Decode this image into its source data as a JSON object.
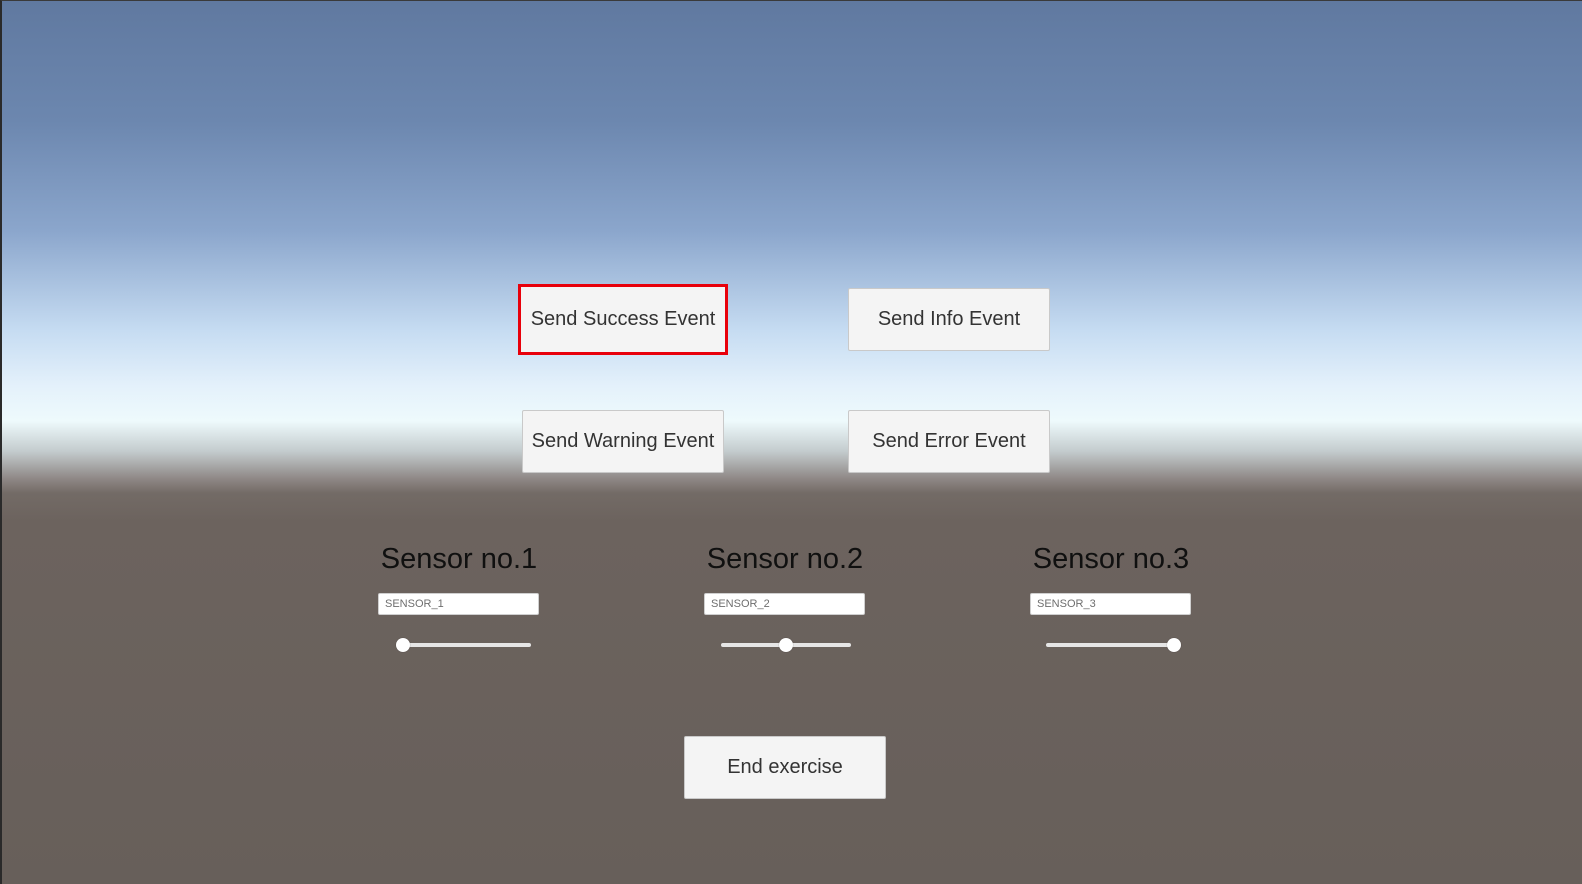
{
  "buttons": {
    "success": "Send Success Event",
    "info": "Send Info Event",
    "warning": "Send Warning Event",
    "error": "Send Error Event",
    "end": "End exercise"
  },
  "highlight_color": "#e8000b",
  "sensors": [
    {
      "title": "Sensor no.1",
      "input_value": "SENSOR_1",
      "slider_value": 0.0
    },
    {
      "title": "Sensor no.2",
      "input_value": "SENSOR_2",
      "slider_value": 0.5
    },
    {
      "title": "Sensor no.3",
      "input_value": "SENSOR_3",
      "slider_value": 1.0
    }
  ]
}
